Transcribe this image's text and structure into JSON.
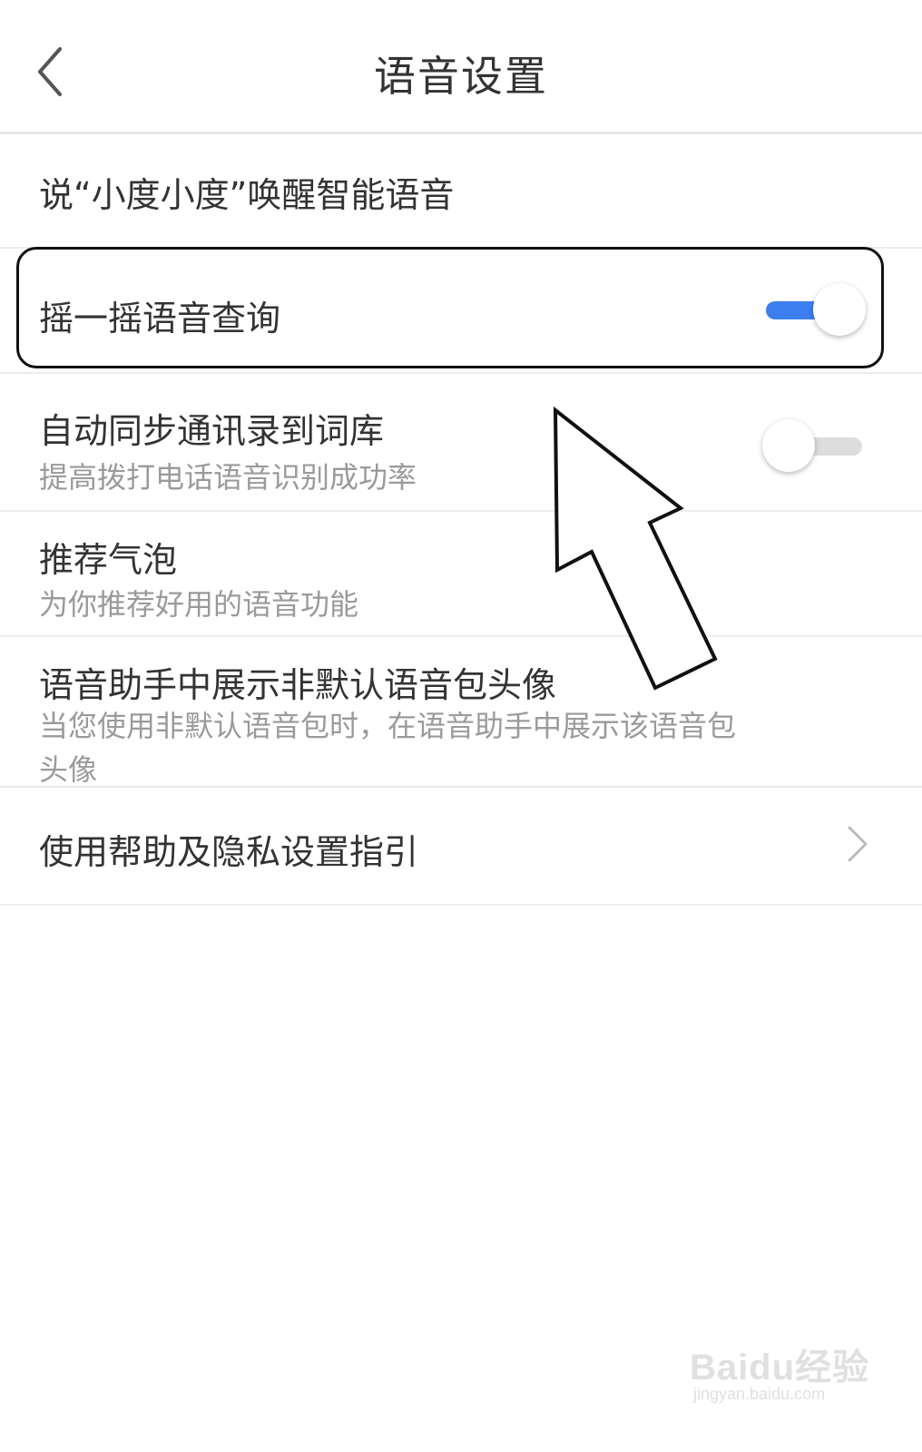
{
  "header": {
    "back_icon": "chevron-left-icon",
    "title": "语音设置"
  },
  "settings": {
    "wake_word": {
      "title": "说“小度小度”唤醒智能语音"
    },
    "shake_query": {
      "title": "摇一摇语音查询",
      "enabled": true
    },
    "sync_contacts": {
      "title": "自动同步通讯录到词库",
      "subtitle": "提高拨打电话语音识别成功率",
      "enabled": false
    },
    "recommend_bubble": {
      "title": "推荐气泡",
      "subtitle": "为你推荐好用的语音功能"
    },
    "show_avatar": {
      "title": "语音助手中展示非默认语音包头像",
      "subtitle": "当您使用非默认语音包时，在语音助手中展示该语音包头像"
    },
    "help_privacy": {
      "title": "使用帮助及隐私设置指引",
      "icon": "chevron-right-icon"
    }
  },
  "annotation": {
    "arrow_icon": "pointer-arrow-icon"
  },
  "watermark": {
    "brand": "Baidu经验",
    "url": "jingyan.baidu.com"
  },
  "colors": {
    "toggle_on": "#3d7ef0",
    "toggle_off": "#dddddd",
    "text_primary": "#333333",
    "text_secondary": "#9a9a9a"
  }
}
